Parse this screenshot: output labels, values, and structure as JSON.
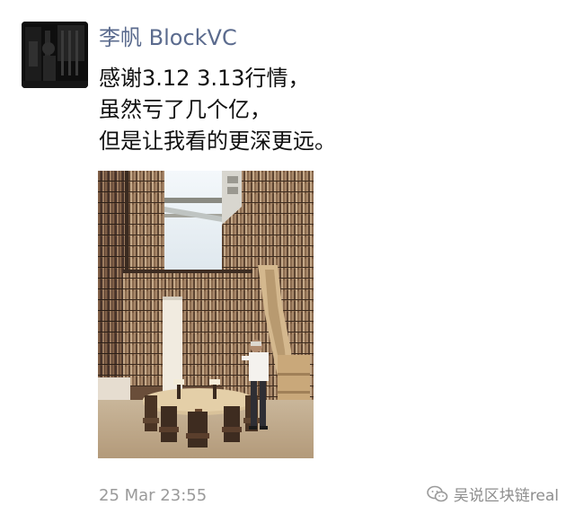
{
  "post": {
    "author": "李帆 BlockVC",
    "lines": [
      "感谢3.12 3.13行情，",
      "虽然亏了几个亿，",
      "但是让我看的更深更远。"
    ],
    "timestamp": "25 Mar 23:55"
  },
  "watermark": {
    "text": "吴说区块链real",
    "icon": "wechat-icon"
  },
  "images": {
    "avatar": "portrait-photo",
    "photo": "library-bookshelf-photo"
  },
  "colors": {
    "author_name": "#5b6b8e",
    "body_text": "#111111",
    "timestamp": "#9a9a9a"
  }
}
